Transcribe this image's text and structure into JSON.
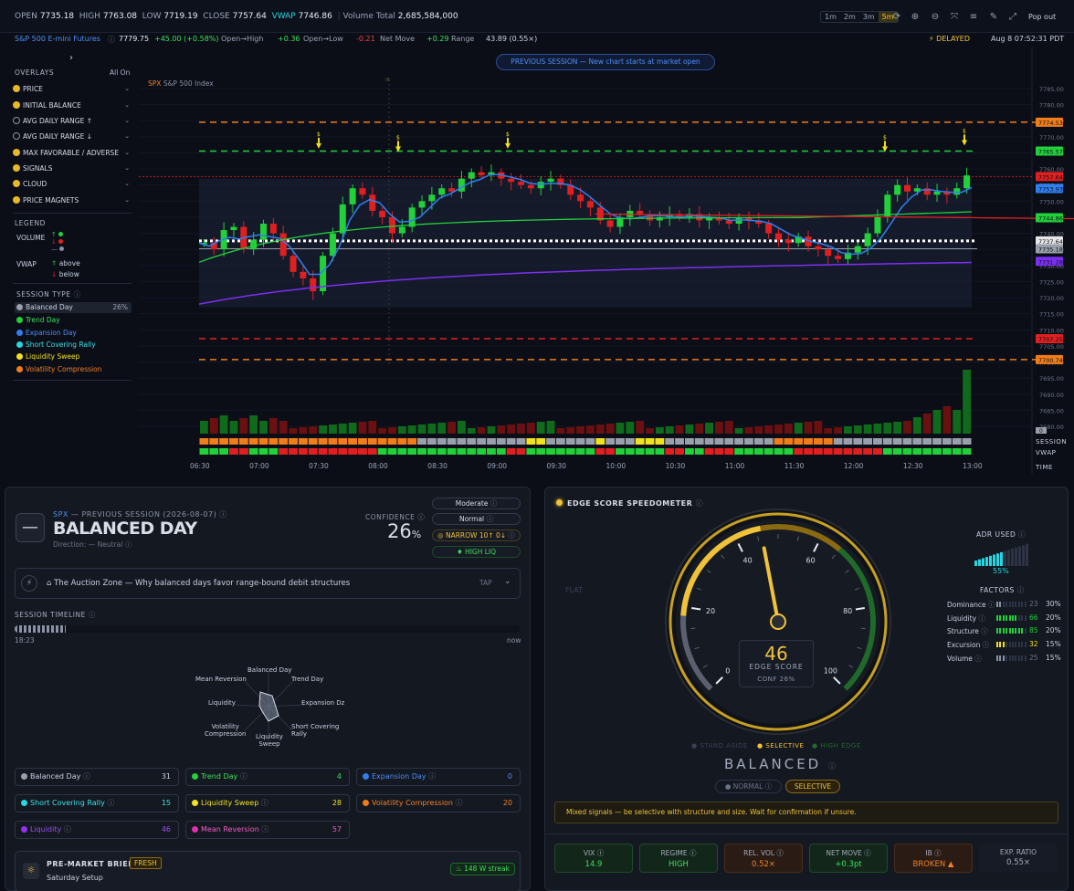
{
  "topbar": {
    "open_label": "OPEN",
    "open": "7735.18",
    "high_label": "HIGH",
    "high": "7763.08",
    "low_label": "LOW",
    "low": "7719.19",
    "close_label": "CLOSE",
    "close": "7757.64",
    "vwap_label": "VWAP",
    "vwap": "7746.86",
    "volume_label": "Volume Total",
    "volume": "2,685,584,000",
    "timeframes": [
      "1m",
      "2m",
      "3m",
      "5m"
    ],
    "active_timeframe": "5m",
    "popout": "Pop out"
  },
  "subbar": {
    "symbol": "S&P 500 E-mini Futures",
    "price": "7779.75",
    "change": "+45.00 (+0.58%)",
    "open_high_label": "Open→High",
    "open_high": "+0.36",
    "open_low_label": "Open→Low",
    "open_low": "-0.21",
    "net_move_label": "Net Move",
    "net_move": "+0.29",
    "range_label": "Range",
    "range": "43.89 (0.55×)",
    "delayed": "DELAYED",
    "date_time": "Aug 8 07:52:31 PDT"
  },
  "overlays": {
    "title": "OVERLAYS",
    "all_on": "All On",
    "items": [
      {
        "label": "PRICE",
        "on": true
      },
      {
        "label": "INITIAL BALANCE",
        "on": true
      },
      {
        "label": "AVG DAILY RANGE ↑",
        "on": false
      },
      {
        "label": "AVG DAILY RANGE ↓",
        "on": false
      },
      {
        "label": "MAX FAVORABLE / ADVERSE",
        "on": true
      },
      {
        "label": "SIGNALS",
        "on": true
      },
      {
        "label": "CLOUD",
        "on": true
      },
      {
        "label": "PRICE MAGNETS",
        "on": true
      }
    ],
    "legend_title": "LEGEND",
    "legend_volume": "VOLUME",
    "legend_vwap": "VWAP",
    "legend_above": "above",
    "legend_below": "below",
    "session_type_title": "SESSION TYPE",
    "session_types": [
      {
        "label": "Balanced Day",
        "pct": "26%",
        "color": "#9aa0ab"
      },
      {
        "label": "Trend Day",
        "pct": "",
        "color": "#22d13a"
      },
      {
        "label": "Expansion Day",
        "pct": "",
        "color": "#2f7ff0"
      },
      {
        "label": "Short Covering Rally",
        "pct": "",
        "color": "#27d6e0"
      },
      {
        "label": "Liquidity Sweep",
        "pct": "",
        "color": "#f2e11e"
      },
      {
        "label": "Volatility Compression",
        "pct": "",
        "color": "#f07d1a"
      }
    ]
  },
  "chart": {
    "banner": "PREVIOUS SESSION — New chart starts at market open",
    "index_code": "SPX",
    "index_name": "S&P 500 Index",
    "y_ticks": [
      "7785.00",
      "7780.00",
      "7775.00",
      "7770.00",
      "7765.00",
      "7760.00",
      "7755.00",
      "7750.00",
      "7745.00",
      "7740.00",
      "7735.00",
      "7730.00",
      "7725.00",
      "7720.00",
      "7715.00",
      "7710.00",
      "7705.00",
      "7700.00",
      "7695.00",
      "7690.00",
      "7685.00",
      "7680.00"
    ],
    "x_ticks": [
      "06:30",
      "07:00",
      "07:30",
      "08:00",
      "08:30",
      "09:00",
      "09:30",
      "10:00",
      "10:30",
      "11:00",
      "11:30",
      "12:00",
      "12:30",
      "13:00"
    ],
    "price_tags": [
      {
        "value": "7774.53",
        "color": "#f07d1a"
      },
      {
        "value": "7765.57",
        "color": "#22d13a"
      },
      {
        "value": "7757.64",
        "color": "#e02020"
      },
      {
        "value": "7753.93",
        "color": "#2f7ff0"
      },
      {
        "value": "7744.86",
        "color": "#22d13a"
      },
      {
        "value": "7737.64",
        "color": "#e6e6e6"
      },
      {
        "value": "7735.18",
        "color": "#9aa0ab"
      },
      {
        "value": "7731.28",
        "color": "#7b2ff0"
      },
      {
        "value": "7707.25",
        "color": "#e02020"
      },
      {
        "value": "7700.74",
        "color": "#f07d1a"
      }
    ],
    "volume_tag": "0",
    "row_labels": [
      "SESSION",
      "VWAP",
      "TIME"
    ],
    "ib_marker": "IB"
  },
  "chart_data": {
    "type": "candlestick",
    "x_range": [
      "06:30",
      "13:00"
    ],
    "ylim": [
      7680,
      7785
    ],
    "levels": {
      "adr_high": 7774.53,
      "mfe": 7765.57,
      "close_line": 7757.64,
      "vwap": 7753.93,
      "ib_mid": 7744.86,
      "magnet": 7737.64,
      "open": 7735.18,
      "lower_band": 7731.28,
      "mae": 7707.25,
      "adr_low": 7700.74
    }
  },
  "left": {
    "sym": "SPX",
    "sub": "— PREVIOUS SESSION (2026-08-07)",
    "title": "BALANCED DAY",
    "direction": "Direction: — Neutral",
    "confidence_label": "CONFIDENCE",
    "confidence": "26",
    "confidence_unit": "%",
    "pills": [
      "Moderate",
      "Normal",
      "NARROW 10↑ 0↓",
      "HIGH LIQ"
    ],
    "auction": "The Auction Zone — Why balanced days favor range-bound debit structures",
    "tap": "TAP",
    "timeline_label": "SESSION TIMELINE",
    "timeline_start": "18:23",
    "timeline_end": "now",
    "radar_labels": [
      "Balanced Day",
      "Trend Day",
      "Expansion Dz",
      "Short Covering\nRally",
      "Liquidity\nSweep",
      "Volatility\nCompression",
      "Liquidity",
      "Mean Reversion"
    ],
    "probs": [
      {
        "label": "Balanced Day",
        "pct": "31",
        "color": "#9aa0ab",
        "text": "#c9d1e0"
      },
      {
        "label": "Trend Day",
        "pct": "4",
        "color": "#22d13a",
        "text": "#3fe05a"
      },
      {
        "label": "Expansion Day",
        "pct": "0",
        "color": "#2f7ff0",
        "text": "#4f8ff5"
      },
      {
        "label": "Short Covering Rally",
        "pct": "15",
        "color": "#27d6e0",
        "text": "#3fe2ea"
      },
      {
        "label": "Liquidity Sweep",
        "pct": "28",
        "color": "#f2e11e",
        "text": "#f2e11e"
      },
      {
        "label": "Volatility Compression",
        "pct": "20",
        "color": "#f07d1a",
        "text": "#f0802a"
      },
      {
        "label": "Liquidity",
        "pct": "46",
        "color": "#9a2ff0",
        "text": "#9a4ff0"
      },
      {
        "label": "Mean Reversion",
        "pct": "57",
        "color": "#e02fb0",
        "text": "#ef5fc5"
      }
    ],
    "brief_title": "PRE-MARKET BRIEF",
    "brief_badge": "FRESH",
    "brief_sub": "Saturday Setup",
    "streak": "148 W streak"
  },
  "right": {
    "title": "EDGE SCORE SPEEDOMETER",
    "flat": "FLAT",
    "gauge_ticks": [
      "0",
      "20",
      "40",
      "60",
      "80",
      "100"
    ],
    "score": "46",
    "score_label": "EDGE SCORE",
    "conf": "CONF 26%",
    "zones": [
      "STAND ASIDE",
      "SELECTIVE",
      "HIGH EDGE"
    ],
    "state": "BALANCED",
    "mode_normal": "NORMAL",
    "mode_selective": "SELECTIVE",
    "message": "Mixed signals — be selective with structure and size. Wait for confirmation if unsure.",
    "adr_label": "ADR USED",
    "adr_value": "55%",
    "adr_fill": 0.55,
    "factors_label": "FACTORS",
    "factors": [
      {
        "label": "Dominance",
        "score": "23",
        "weight": "30%",
        "fill": 0.23,
        "color": "#8a93a6"
      },
      {
        "label": "Liquidity",
        "score": "66",
        "weight": "20%",
        "fill": 0.66,
        "color": "#22d13a"
      },
      {
        "label": "Structure",
        "score": "85",
        "weight": "20%",
        "fill": 0.85,
        "color": "#22d13a"
      },
      {
        "label": "Excursion",
        "score": "32",
        "weight": "15%",
        "fill": 0.32,
        "color": "#f2e11e"
      },
      {
        "label": "Volume",
        "score": "25",
        "weight": "15%",
        "fill": 0.25,
        "color": "#8a93a6"
      }
    ],
    "kpis": [
      {
        "label": "VIX",
        "value": "14.9",
        "color": "#3fe05a",
        "bg": "#13261a",
        "bd": "#1f4a2a"
      },
      {
        "label": "REGIME",
        "value": "HIGH",
        "color": "#3fe05a",
        "bg": "#13261a",
        "bd": "#1f4a2a"
      },
      {
        "label": "REL. VOL",
        "value": "0.52×",
        "color": "#f0802a",
        "bg": "#2a1c14",
        "bd": "#4a2e1c"
      },
      {
        "label": "NET MOVE",
        "value": "+0.3pt",
        "color": "#3fe05a",
        "bg": "#13261a",
        "bd": "#1f4a2a"
      },
      {
        "label": "IB",
        "value": "BROKEN ▲",
        "color": "#f0802a",
        "bg": "#2a1c14",
        "bd": "#4a2e1c"
      },
      {
        "label": "EXP. RATIO",
        "value": "0.55×",
        "color": "#a3aabb",
        "bg": "#171b25",
        "bd": "#171b25"
      }
    ]
  }
}
